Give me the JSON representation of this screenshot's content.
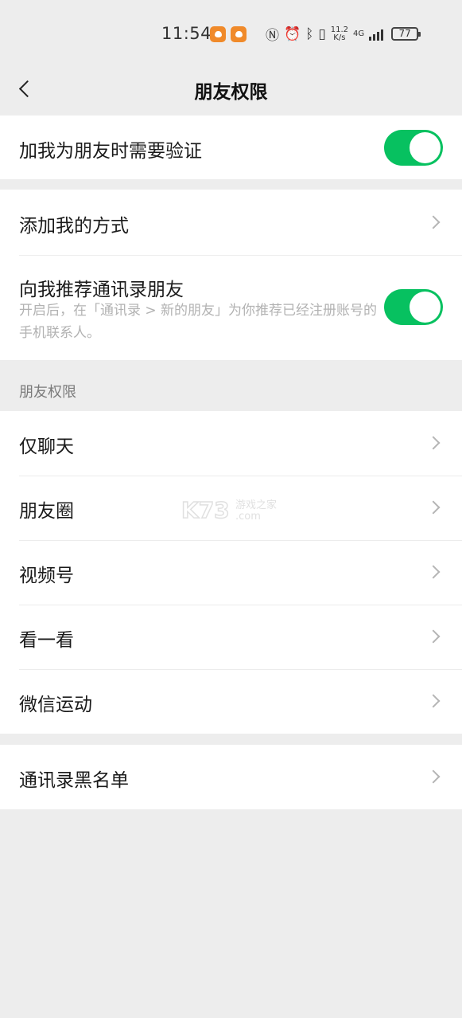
{
  "status_bar": {
    "time": "11:54",
    "net_speed_value": "11.2",
    "net_speed_unit": "K/s",
    "network_type": "4G",
    "battery": "77"
  },
  "header": {
    "title": "朋友权限"
  },
  "group1": {
    "verify_label": "加我为朋友时需要验证",
    "verify_enabled": true
  },
  "group2": {
    "add_methods_label": "添加我的方式",
    "recommend_label": "向我推荐通讯录朋友",
    "recommend_desc": "开启后，在「通讯录 > 新的朋友」为你推荐已经注册账号的手机联系人。",
    "recommend_enabled": true
  },
  "section": {
    "header": "朋友权限",
    "items": [
      {
        "label": "仅聊天"
      },
      {
        "label": "朋友圈"
      },
      {
        "label": "视频号"
      },
      {
        "label": "看一看"
      },
      {
        "label": "微信运动"
      }
    ]
  },
  "group4": {
    "blacklist_label": "通讯录黑名单"
  },
  "watermark": {
    "brand": "K73",
    "text": "游戏之家",
    "domain": ".com"
  },
  "colors": {
    "accent": "#07c160",
    "background": "#ededed",
    "card": "#ffffff",
    "secondary_text": "#b2b2b2"
  }
}
